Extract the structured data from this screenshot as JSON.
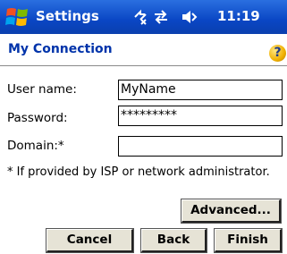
{
  "titlebar": {
    "app_title": "Settings",
    "time": "11:19"
  },
  "header": {
    "title": "My Connection",
    "help_symbol": "?"
  },
  "form": {
    "username_label": "User name:",
    "username_value": "MyName",
    "password_label": "Password:",
    "password_value": "*********",
    "domain_label": "Domain:*",
    "domain_value": ""
  },
  "note": "* If provided by ISP or network administrator.",
  "buttons": {
    "advanced": "Advanced...",
    "cancel": "Cancel",
    "back": "Back",
    "finish": "Finish"
  },
  "icons": [
    "windows-start-icon",
    "connectivity-icon",
    "sync-icon",
    "volume-icon",
    "help-icon"
  ]
}
